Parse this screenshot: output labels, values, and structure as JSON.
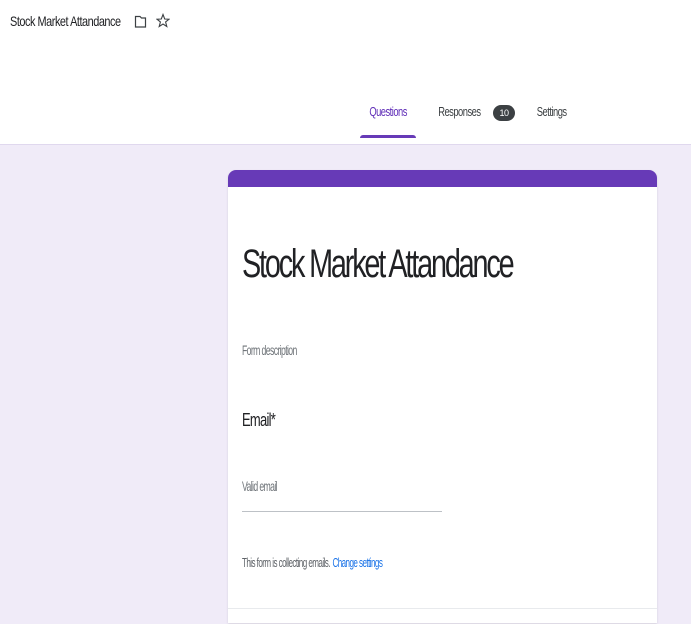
{
  "header": {
    "doc_title": "Stock Market Attandance",
    "icons": [
      "folder-icon",
      "star-icon"
    ]
  },
  "tabs": [
    {
      "label": "Questions",
      "active": true
    },
    {
      "label": "Responses",
      "badge": "10"
    },
    {
      "label": "Settings"
    }
  ],
  "form": {
    "title": "Stock Market Attandance",
    "description_placeholder": "Form description",
    "question": {
      "label": "Email",
      "required_marker": "*",
      "placeholder": "Valid email"
    },
    "notice_text": "This form is collecting emails.",
    "notice_link": "Change settings"
  },
  "colors": {
    "accent": "#673ab7",
    "canvas_bg": "#f0ebf8",
    "link": "#1a73e8"
  }
}
